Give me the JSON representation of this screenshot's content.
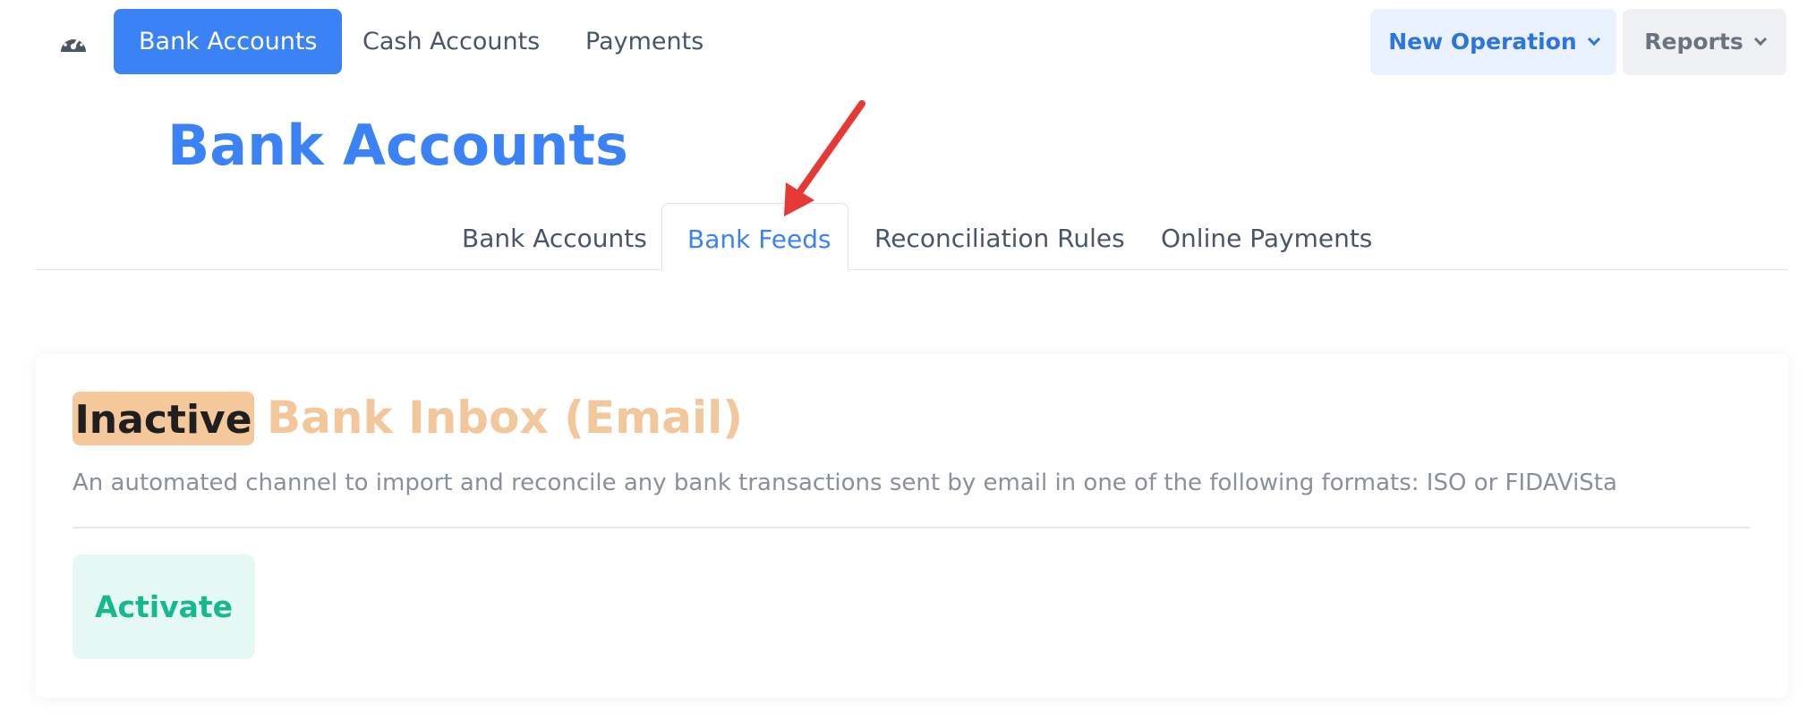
{
  "nav": {
    "dashboard_icon": "speedometer-icon",
    "items": [
      {
        "label": "Bank Accounts",
        "active": true
      },
      {
        "label": "Cash Accounts",
        "active": false
      },
      {
        "label": "Payments",
        "active": false
      }
    ],
    "new_operation": "New Operation",
    "reports": "Reports"
  },
  "page": {
    "title": "Bank Accounts"
  },
  "tabs": [
    {
      "label": "Bank Accounts",
      "active": false
    },
    {
      "label": "Bank Feeds",
      "active": true
    },
    {
      "label": "Reconciliation Rules",
      "active": false
    },
    {
      "label": "Online Payments",
      "active": false
    }
  ],
  "feed": {
    "status": "Inactive",
    "title": "Bank Inbox (Email)",
    "description": "An automated channel to import and reconcile any bank transactions sent by email in one of the following formats: ISO or FIDAViSta",
    "action": "Activate"
  },
  "colors": {
    "accent": "#3b82f6",
    "inactive_badge": "#f5c89c",
    "activate_text": "#17b890",
    "annotation_arrow": "#e53935"
  }
}
